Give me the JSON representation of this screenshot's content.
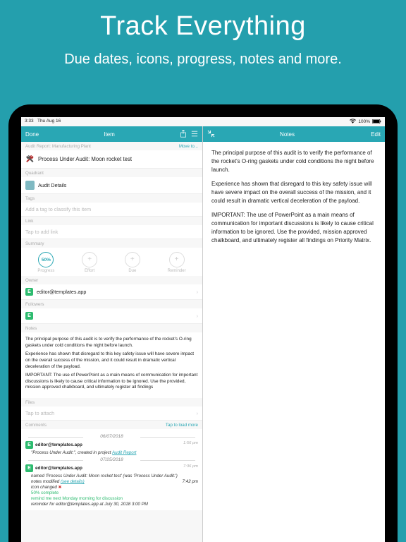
{
  "promo": {
    "title": "Track Everything",
    "subtitle": "Due dates, icons, progress, notes and more."
  },
  "statusbar": {
    "time": "3:33",
    "date": "Thu Aug 16",
    "battery": "100%"
  },
  "nav": {
    "left": {
      "done": "Done",
      "title": "Item"
    },
    "right": {
      "title": "Notes",
      "edit": "Edit"
    }
  },
  "sections": {
    "report_name": "Audit Report: Manufacturing Plant",
    "move_to": "Move to...",
    "item_title": "Process Under Audit: Moon rocket test",
    "quadrant": "Quadrant",
    "quadrant_value": "Audit Details",
    "tags": "Tags",
    "tags_placeholder": "Add a tag to classify this item",
    "link": "Link",
    "link_placeholder": "Tap to add link",
    "summary": "Summary",
    "owner": "Owner",
    "owner_value": "editor@templates.app",
    "followers": "Followers",
    "notes": "Notes",
    "files": "Files",
    "files_placeholder": "Tap to attach",
    "comments": "Comments",
    "load_more": "Tap to load more"
  },
  "circles": {
    "progress_value": "50%",
    "progress": "Progress",
    "effort": "Effort",
    "due": "Due",
    "reminder": "Reminder"
  },
  "notes": {
    "p1": "The principal purpose of this audit is to verify the performance of the rocket's O-ring gaskets under cold conditions the night before launch.",
    "p2": "Experience has shown that disregard to this key safety issue will have severe impact on the overall success of the mission, and it could result in dramatic vertical deceleration of the payload.",
    "p3": "IMPORTANT: The use of PowerPoint as a main means of communication for important discussions is likely to cause critical information to be ignored. Use the provided, mission approved chalkboard, and ultimately register all findings on Priority Matrix."
  },
  "notes_short": {
    "p3": "IMPORTANT: The use of PowerPoint as a main means of communication for important discussions is likely to cause critical information to be ignored. Use the provided, mission approved chalkboard, and ultimately register all findings"
  },
  "comments": {
    "date1": "06/07/2018",
    "c1": {
      "who": "editor@templates.app",
      "time": "1:56 pm",
      "body_prefix": "\"Process Under Audit:\", created in project ",
      "body_link": "Audit Report"
    },
    "date2": "07/25/2018",
    "c2": {
      "who": "editor@templates.app",
      "time": "7:36 pm",
      "l1": "named 'Process Under Audit: Moon rocket test' (was 'Process Under Audit:')",
      "l2a": "notes modified ",
      "l2b": "(see details)",
      "l2time": "7:42 pm",
      "l3": "icon changed ",
      "l4": "50% complete",
      "l5": "remind me next Monday morning for discussion",
      "l6": "reminder for editor@templates.app at July 30, 2018 3:00 PM"
    }
  }
}
